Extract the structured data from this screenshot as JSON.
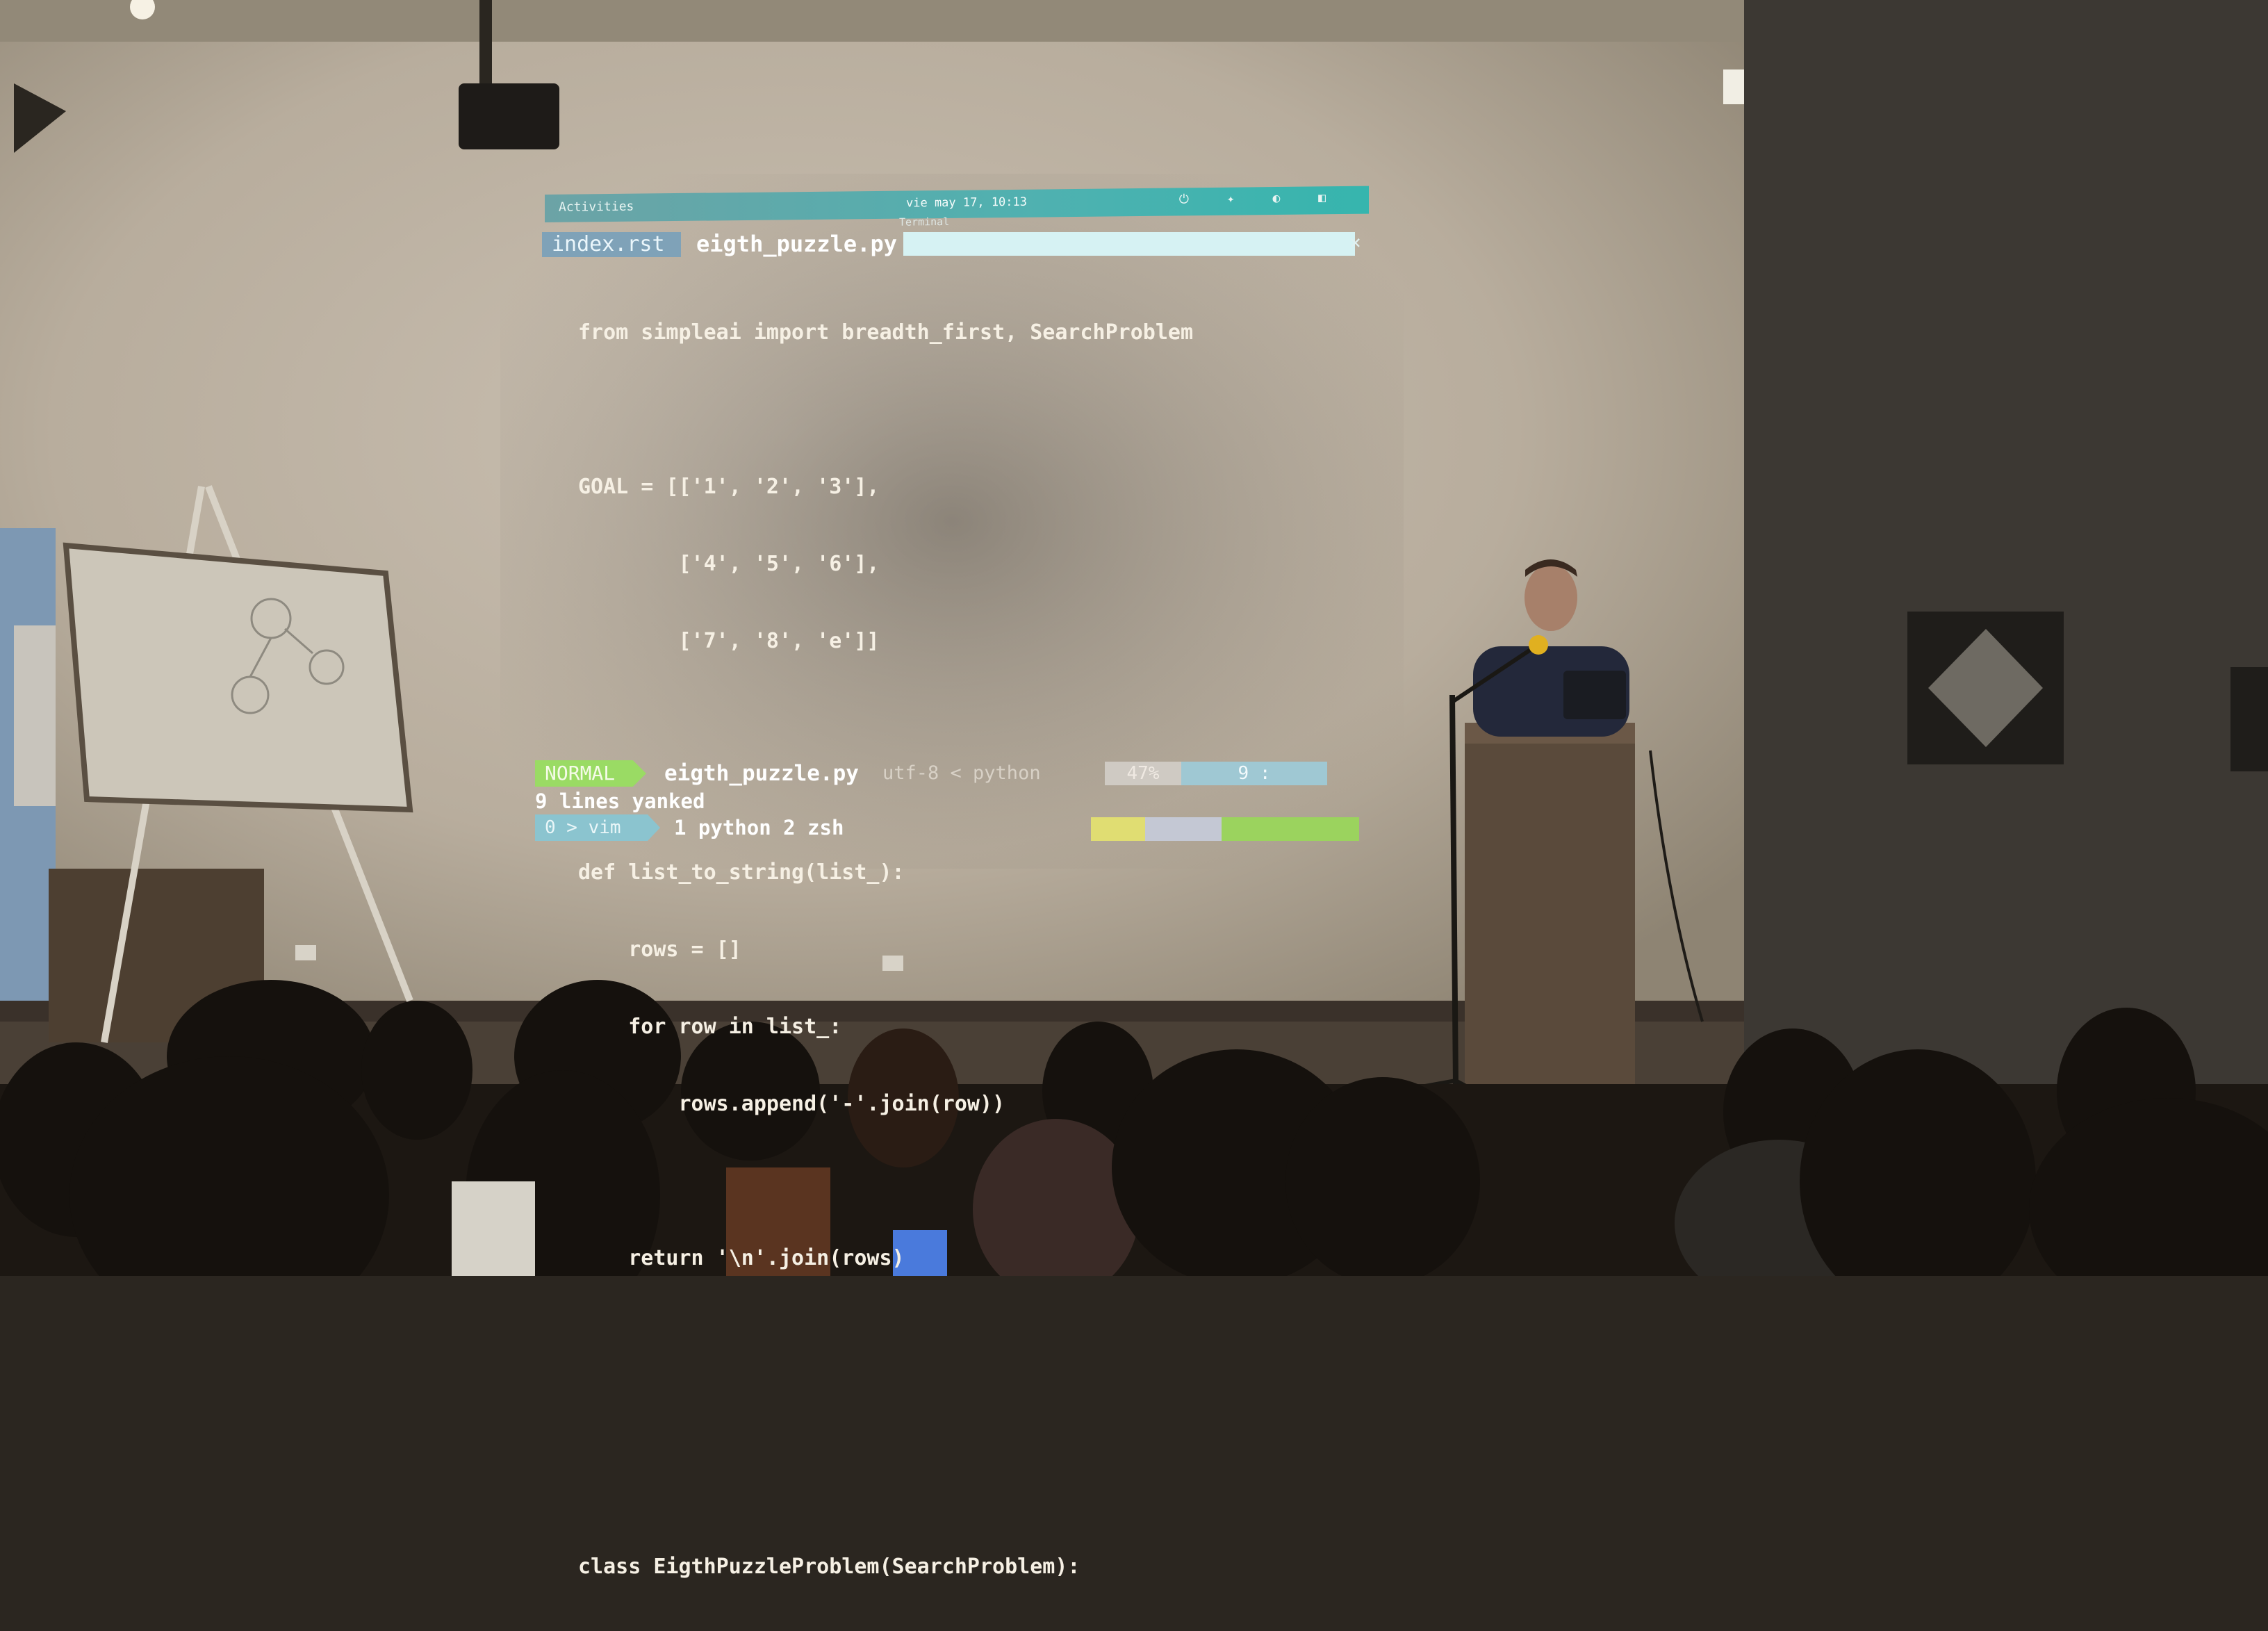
{
  "desktop": {
    "activities_label": "Activities",
    "clock": "vie may 17, 10:13",
    "window_label": "Terminal"
  },
  "editor": {
    "tabs": [
      "index.rst",
      "eigth_puzzle.py"
    ],
    "code_lines": [
      "from simpleai import breadth_first, SearchProblem",
      "",
      "GOAL = [['1', '2', '3'],",
      "        ['4', '5', '6'],",
      "        ['7', '8', 'e']]",
      "",
      "",
      "def list_to_string(list_):",
      "    rows = []",
      "    for row in list_:",
      "        rows.append('-'.join(row))",
      "",
      "    return '\\n'.join(rows)",
      "",
      "",
      "",
      "class EigthPuzzleProblem(SearchProblem):"
    ],
    "status": {
      "mode": "NORMAL",
      "file": "eigth_puzzle.py",
      "info": "utf-8 < python",
      "percent": "47%",
      "position": "9 :"
    },
    "message": "9 lines yanked"
  },
  "tmux": {
    "session": "0 > vim",
    "windows": "1 python  2 zsh"
  }
}
